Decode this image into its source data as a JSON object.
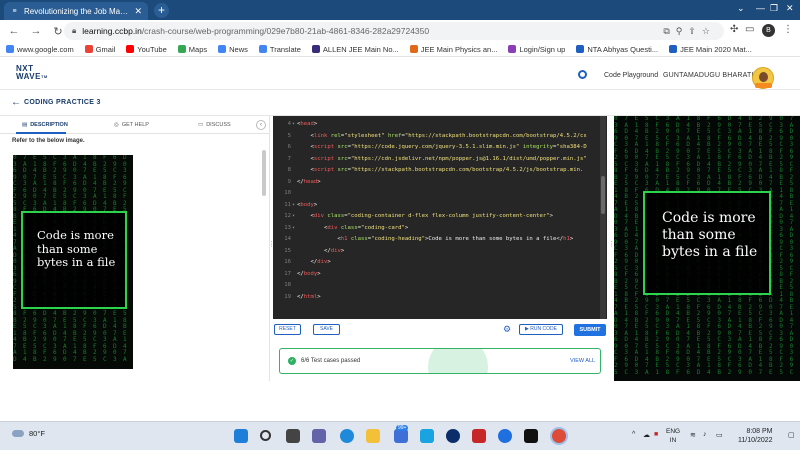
{
  "browser": {
    "tab_title": "Revolutionizing the Job Market | ...",
    "url_host": "learning.ccbp.in",
    "url_path": "/crash-course/web-programming/029e7b80-21ab-4861-8346-282a29724350",
    "profile_initial": "B",
    "bookmarks": [
      {
        "label": "www.google.com",
        "color": "#4285f4"
      },
      {
        "label": "Gmail",
        "color": "#ea4335"
      },
      {
        "label": "YouTube",
        "color": "#ff0000"
      },
      {
        "label": "Maps",
        "color": "#34a853"
      },
      {
        "label": "News",
        "color": "#4285f4"
      },
      {
        "label": "Translate",
        "color": "#4285f4"
      },
      {
        "label": "ALLEN JEE Main No...",
        "color": "#3b2c7a"
      },
      {
        "label": "JEE Main Physics an...",
        "color": "#e06a1b"
      },
      {
        "label": "Login/Sign up",
        "color": "#8b3fb6"
      },
      {
        "label": "NTA Abhyas Questi...",
        "color": "#1f5fbf"
      },
      {
        "label": "JEE Main 2020 Mat...",
        "color": "#1f5fbf"
      }
    ]
  },
  "site": {
    "logo_top": "NXT",
    "logo_bottom": "WAVE",
    "logo_tm": "TM",
    "code_playground": "Code Playground",
    "user_name": "GUNTAMADUGU BHARATH",
    "practice_title": "CODING PRACTICE 3"
  },
  "left_tabs": {
    "description": "DESCRIPTION",
    "get_help": "GET HELP",
    "discuss": "DISCUSS"
  },
  "description": {
    "refer_text": "Refer to the below image.",
    "card_text": "Code is more than some bytes in a file"
  },
  "editor_lines": [
    {
      "n": "4",
      "fold": "▾",
      "html": "<span class='w'>&lt;</span><span class='t'>head</span><span class='w'>&gt;</span>"
    },
    {
      "n": "5",
      "fold": "",
      "html": "&nbsp;&nbsp;&nbsp;&nbsp;<span class='w'>&lt;</span><span class='t'>link</span> <span class='a'>rel</span>=<span class='s'>\"stylesheet\"</span> <span class='a'>href</span>=<span class='s'>\"https://stackpath.bootstrapcdn.com/bootstrap/4.5.2/cs</span>"
    },
    {
      "n": "6",
      "fold": "",
      "html": "&nbsp;&nbsp;&nbsp;&nbsp;<span class='w'>&lt;</span><span class='t'>script</span> <span class='a'>src</span>=<span class='s'>\"https://code.jquery.com/jquery-3.5.1.slim.min.js\"</span> <span class='a'>integrity</span>=<span class='s'>\"sha384-D</span>"
    },
    {
      "n": "7",
      "fold": "",
      "html": "&nbsp;&nbsp;&nbsp;&nbsp;<span class='w'>&lt;</span><span class='t'>script</span> <span class='a'>src</span>=<span class='s'>\"https://cdn.jsdelivr.net/npm/popper.js@1.16.1/dist/umd/popper.min.js\"</span>"
    },
    {
      "n": "8",
      "fold": "",
      "html": "&nbsp;&nbsp;&nbsp;&nbsp;<span class='w'>&lt;</span><span class='t'>script</span> <span class='a'>src</span>=<span class='s'>\"https://stackpath.bootstrapcdn.com/bootstrap/4.5.2/js/bootstrap.min.</span>"
    },
    {
      "n": "9",
      "fold": "",
      "html": "<span class='w'>&lt;/</span><span class='t'>head</span><span class='w'>&gt;</span>"
    },
    {
      "n": "10",
      "fold": "",
      "html": ""
    },
    {
      "n": "11",
      "fold": "▾",
      "html": "<span class='w'>&lt;</span><span class='t'>body</span><span class='w'>&gt;</span>"
    },
    {
      "n": "12",
      "fold": "▾",
      "html": "&nbsp;&nbsp;&nbsp;&nbsp;<span class='w'>&lt;</span><span class='t'>div</span> <span class='a'>class</span>=<span class='s'>\"coding-container d-flex flex-column justify-content-center\"</span><span class='w'>&gt;</span>"
    },
    {
      "n": "13",
      "fold": "▾",
      "html": "&nbsp;&nbsp;&nbsp;&nbsp;&nbsp;&nbsp;&nbsp;&nbsp;<span class='w'>&lt;</span><span class='t'>div</span> <span class='a'>class</span>=<span class='s'>\"coding-card\"</span><span class='w'>&gt;</span>"
    },
    {
      "n": "14",
      "fold": "",
      "html": "&nbsp;&nbsp;&nbsp;&nbsp;&nbsp;&nbsp;&nbsp;&nbsp;&nbsp;&nbsp;&nbsp;&nbsp;<span class='w'>&lt;</span><span class='t'>h1</span> <span class='a'>class</span>=<span class='s'>\"coding-heading\"</span><span class='w'>&gt;Code is more than some bytes in a file&lt;/</span><span class='t'>h1</span><span class='w'>&gt;</span>"
    },
    {
      "n": "15",
      "fold": "",
      "html": "&nbsp;&nbsp;&nbsp;&nbsp;&nbsp;&nbsp;&nbsp;&nbsp;<span class='w'>&lt;/</span><span class='t'>div</span><span class='w'>&gt;</span>"
    },
    {
      "n": "16",
      "fold": "",
      "html": "&nbsp;&nbsp;&nbsp;&nbsp;<span class='w'>&lt;/</span><span class='t'>div</span><span class='w'>&gt;</span>"
    },
    {
      "n": "17",
      "fold": "",
      "html": "<span class='w'>&lt;/</span><span class='t'>body</span><span class='w'>&gt;</span>"
    },
    {
      "n": "18",
      "fold": "",
      "html": ""
    },
    {
      "n": "19",
      "fold": "",
      "html": "<span class='w'>&lt;/</span><span class='t'>html</span><span class='w'>&gt;</span>"
    }
  ],
  "actions": {
    "reset": "RESET",
    "save": "SAVE",
    "run_code": "▶ RUN CODE",
    "submit": "SUBMIT"
  },
  "result": {
    "message": "6/6 Test cases passed",
    "view_all": "VIEW ALL"
  },
  "output": {
    "card_text": "Code is more than some bytes in a file"
  },
  "taskbar": {
    "temperature": "80°F",
    "language_top": "ENG",
    "language_bottom": "IN",
    "time": "8:08 PM",
    "date": "11/10/2022",
    "badge": "99+"
  },
  "colors": {
    "brand_navy": "#183b6b",
    "accent_blue": "#1f72e0",
    "matrix_green": "#2bd44b",
    "success_green": "#2bb160"
  }
}
